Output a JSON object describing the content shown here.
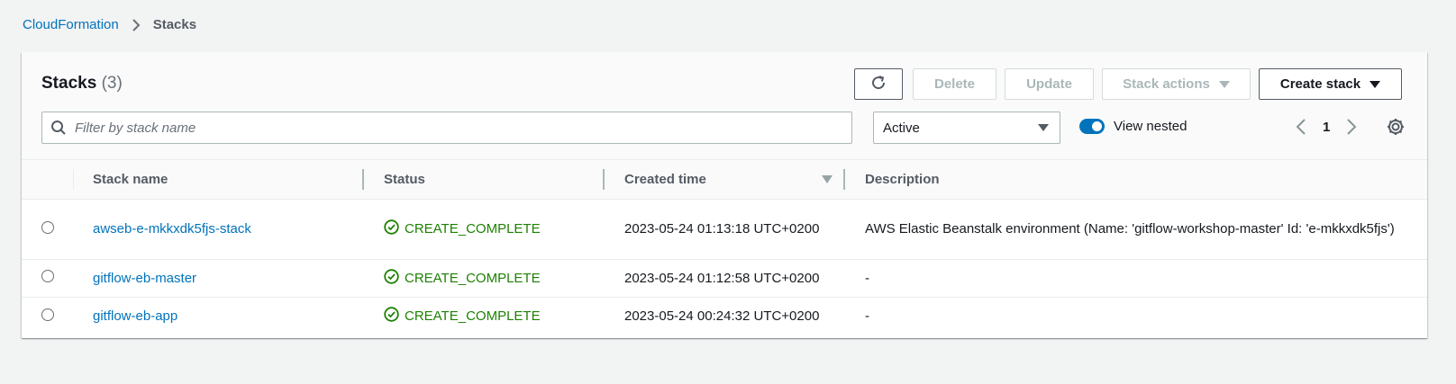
{
  "breadcrumb": {
    "root": "CloudFormation",
    "current": "Stacks"
  },
  "header": {
    "title": "Stacks",
    "count": "(3)",
    "refresh_icon": "refresh-icon",
    "delete_label": "Delete",
    "update_label": "Update",
    "stack_actions_label": "Stack actions",
    "create_stack_label": "Create stack"
  },
  "filter": {
    "placeholder": "Filter by stack name",
    "status_select": "Active",
    "view_nested_label": "View nested",
    "view_nested_on": true
  },
  "pagination": {
    "page": "1"
  },
  "table": {
    "columns": [
      "Stack name",
      "Status",
      "Created time",
      "Description"
    ],
    "rows": [
      {
        "name": "awseb-e-mkkxdk5fjs-stack",
        "status": "CREATE_COMPLETE",
        "created": "2023-05-24 01:13:18 UTC+0200",
        "description": "AWS Elastic Beanstalk environment (Name: 'gitflow-workshop-master' Id: 'e-mkkxdk5fjs')"
      },
      {
        "name": "gitflow-eb-master",
        "status": "CREATE_COMPLETE",
        "created": "2023-05-24 01:12:58 UTC+0200",
        "description": "-"
      },
      {
        "name": "gitflow-eb-app",
        "status": "CREATE_COMPLETE",
        "created": "2023-05-24 00:24:32 UTC+0200",
        "description": "-"
      }
    ]
  },
  "colors": {
    "link": "#0073bb",
    "success": "#1d8102",
    "background": "#f2f3f3"
  }
}
